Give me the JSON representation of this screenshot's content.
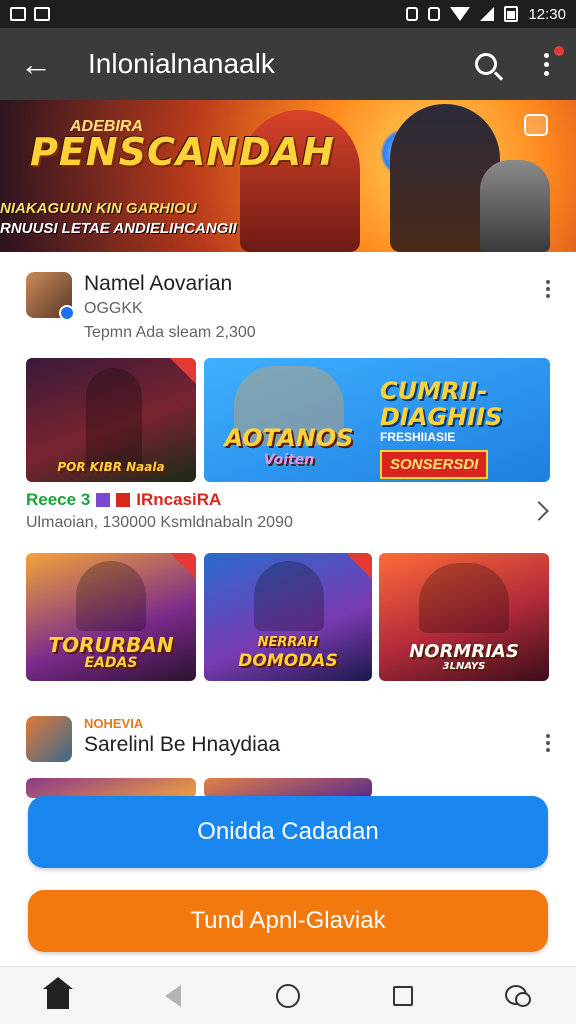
{
  "status_bar": {
    "time": "12:30"
  },
  "app_bar": {
    "title": "Inlonialnanaalk"
  },
  "banner": {
    "supertitle": "ADEBIRA",
    "title": "PENSCANDAH",
    "subtitle_1": "NIAKAGUUN KIN GARHIOU",
    "subtitle_2": "RNUUSI LETAE ANDIELIHCANGII"
  },
  "section_1": {
    "title": "Namel Aovarian",
    "subtitle": "OGGKK",
    "meta": "Tepmn Ada sleam 2,300"
  },
  "cards_row_1": [
    {
      "label": "POR KIBR Naala"
    },
    {
      "label": "AOTANOS",
      "label2": "Voiten",
      "promo_title": "CUMRII-DIAGHIIS",
      "promo_sub": "FRESHIIASIE",
      "promo_tag": "SONSERSDI"
    }
  ],
  "legend": {
    "green_text": "Reece 3",
    "red_text": "IRncasiRA"
  },
  "meta_row": "Ulmaoian, 130000 Ksmldnabaln 2090",
  "cards_row_2": [
    {
      "label": "TORURBAN",
      "label2": "EADAS"
    },
    {
      "label": "NERRAH",
      "label2": "DOMODAS"
    },
    {
      "label": "NORMRIAS",
      "label2": "3LNAYS"
    }
  ],
  "section_2": {
    "tag": "NOHEVIA",
    "title": "Sarelinl Be Hnaydiaa"
  },
  "buttons": {
    "primary": "Onidda Cadadan",
    "secondary": "Tund Apnl-Glaviak"
  },
  "colors": {
    "app_bar": "#3b3b3b",
    "primary_button": "#1a86f0",
    "secondary_button": "#f2790d"
  }
}
